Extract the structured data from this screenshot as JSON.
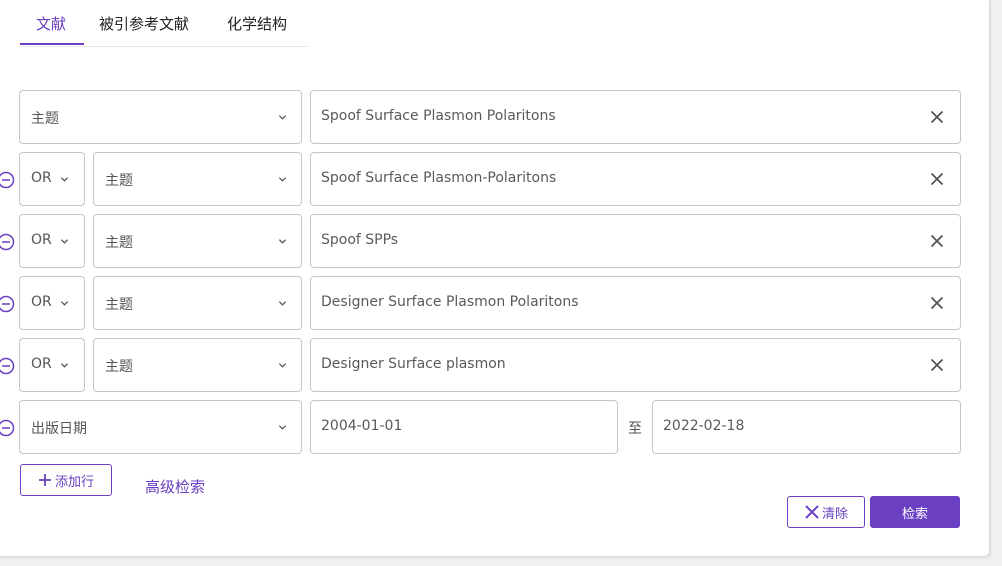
{
  "tabs": [
    {
      "label": "文献"
    },
    {
      "label": "被引参考文献"
    },
    {
      "label": "化学结构"
    }
  ],
  "rows": [
    {
      "operator": "",
      "field": "主题",
      "value": "Spoof Surface Plasmon Polaritons"
    },
    {
      "operator": "OR",
      "field": "主题",
      "value": "Spoof Surface Plasmon-Polaritons"
    },
    {
      "operator": "OR",
      "field": "主题",
      "value": "Spoof SPPs"
    },
    {
      "operator": "OR",
      "field": "主题",
      "value": "Designer Surface Plasmon Polaritons"
    },
    {
      "operator": "OR",
      "field": "主题",
      "value": "Designer Surface plasmon"
    }
  ],
  "date_row": {
    "field": "出版日期",
    "from": "2004-01-01",
    "separator": "至",
    "to": "2022-02-18"
  },
  "actions": {
    "add_row": "添加行",
    "advanced_search": "高级检索",
    "clear": "清除",
    "search": "检索"
  },
  "colors": {
    "accent": "#6a3fc1",
    "border": "#c6c6cc"
  }
}
